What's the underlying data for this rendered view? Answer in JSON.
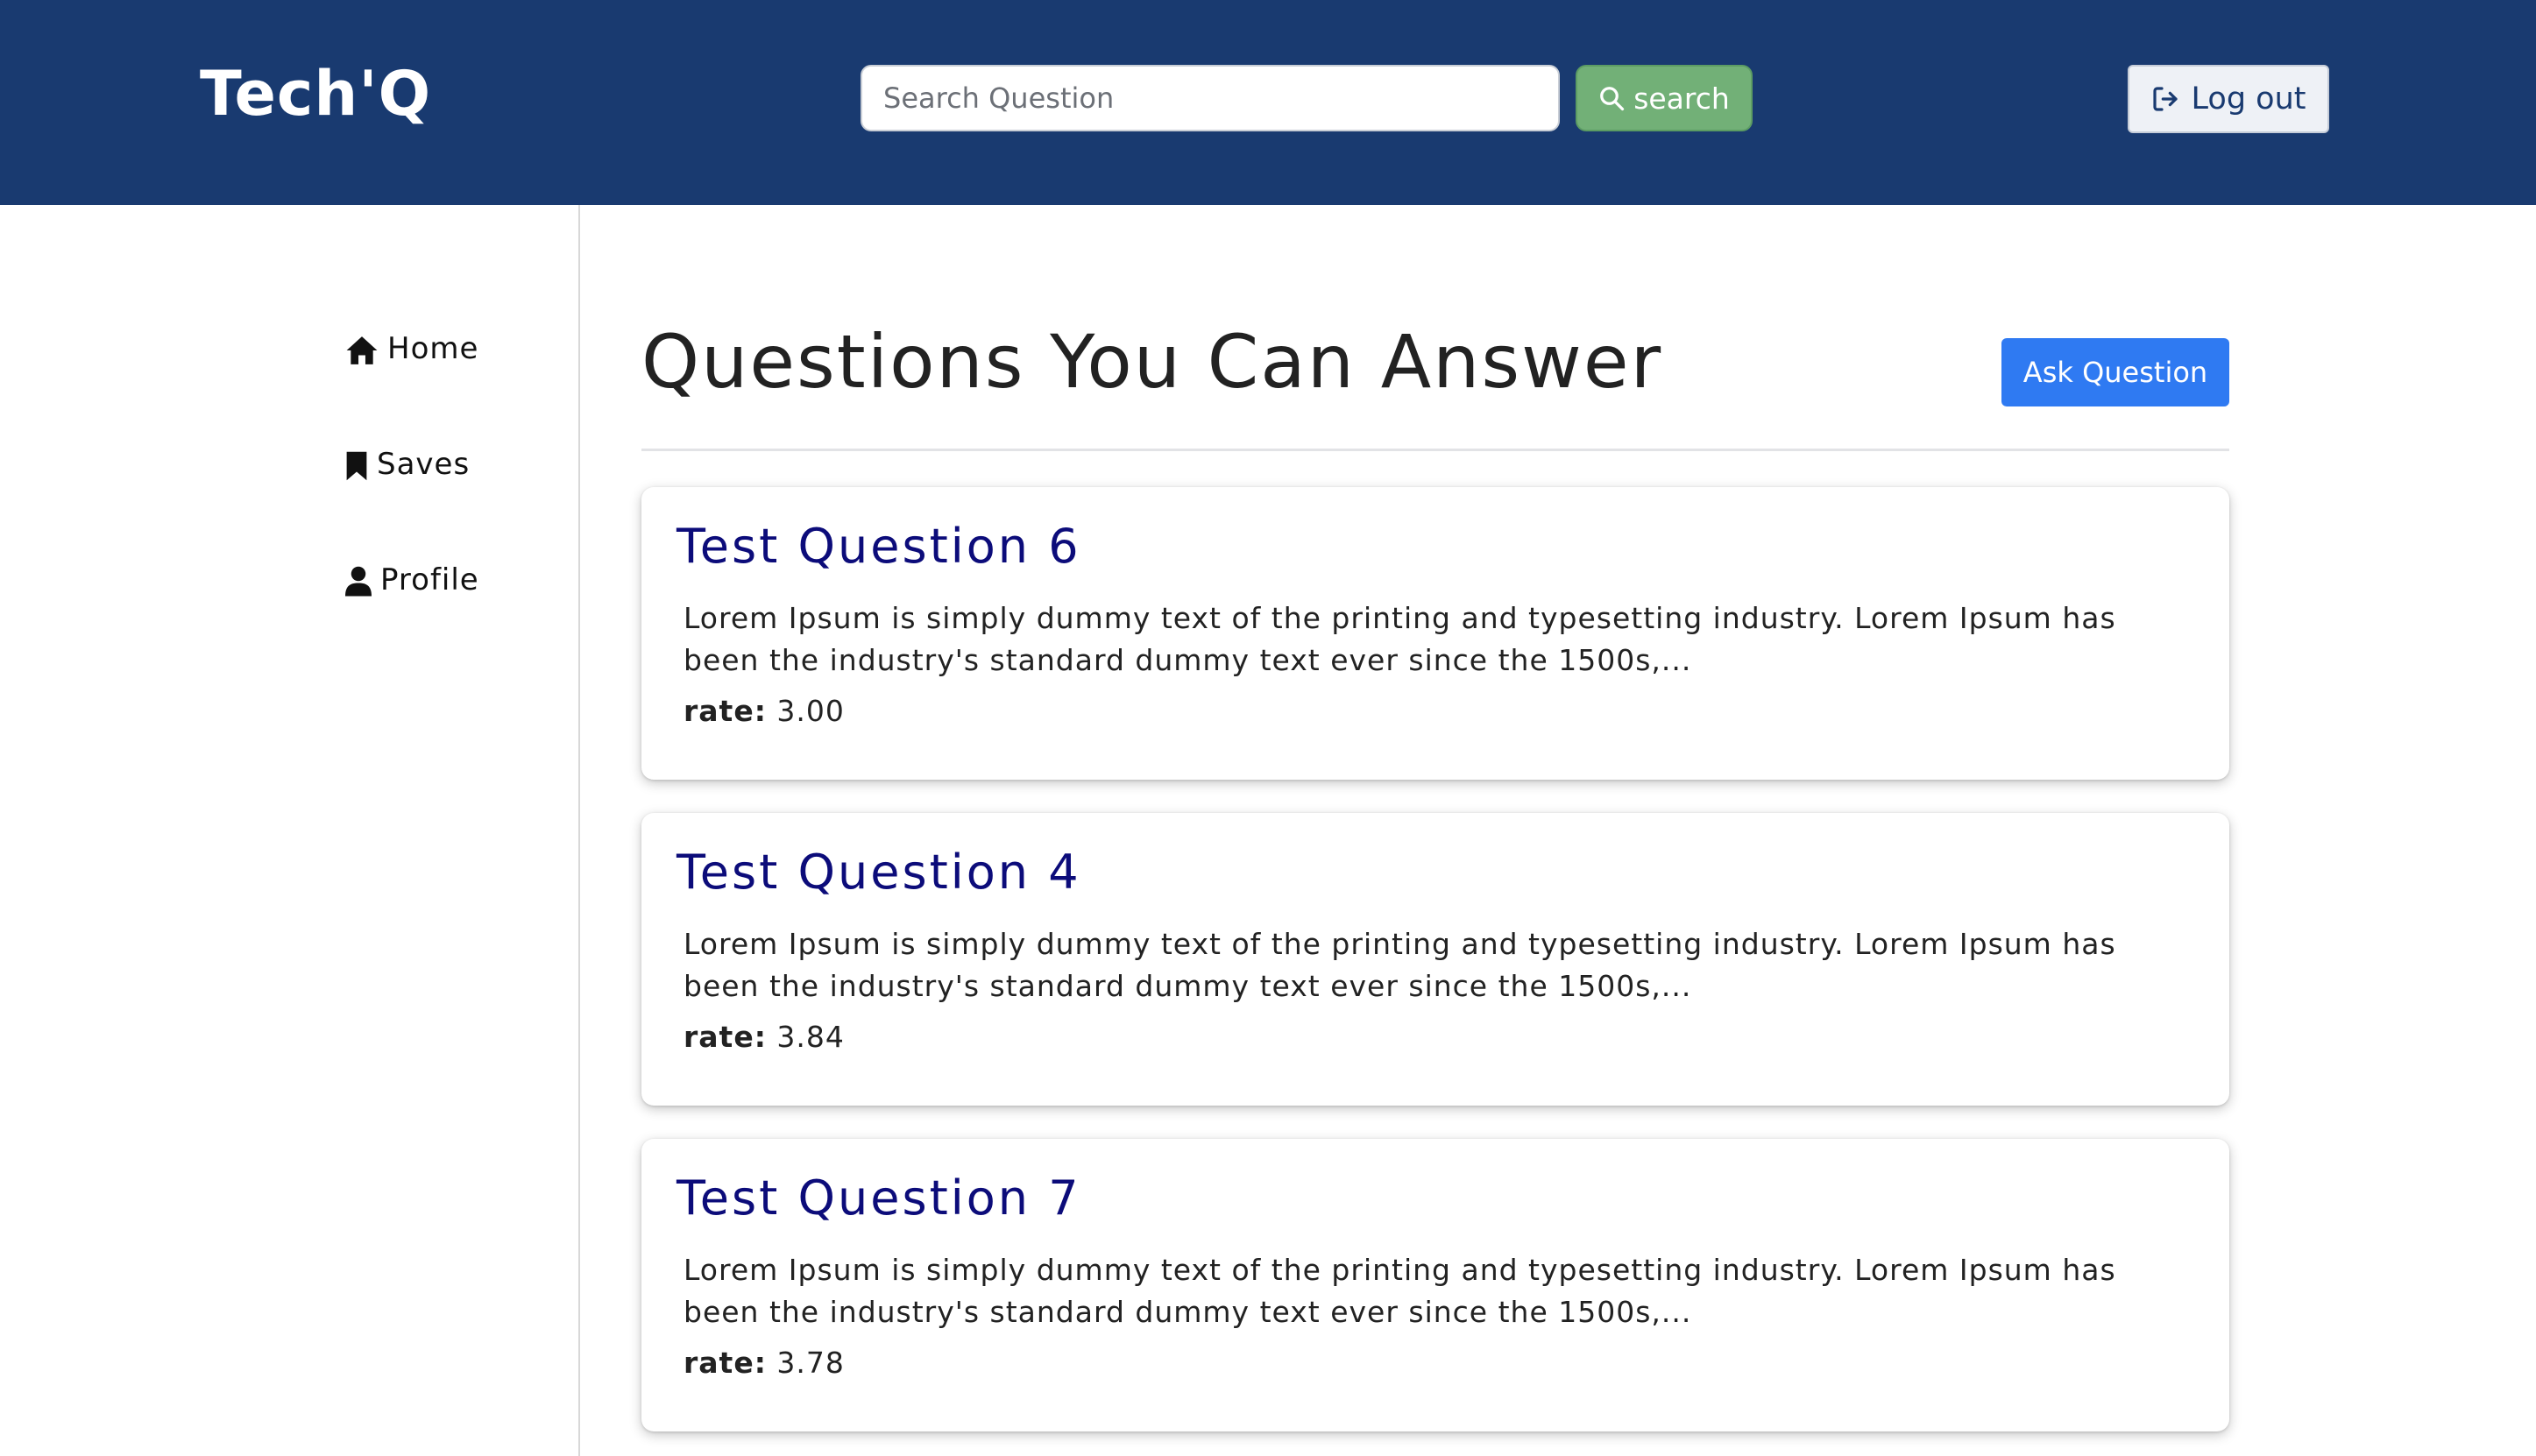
{
  "header": {
    "brand": "Tech'Q",
    "search_placeholder": "Search Question",
    "search_button": "search",
    "logout_button": "Log out"
  },
  "sidebar": {
    "items": [
      {
        "label": "Home",
        "icon": "home-icon"
      },
      {
        "label": "Saves",
        "icon": "bookmark-icon"
      },
      {
        "label": "Profile",
        "icon": "user-icon"
      }
    ]
  },
  "main": {
    "title": "Questions You Can Answer",
    "ask_button": "Ask Question",
    "rate_label": "rate:",
    "questions": [
      {
        "title": "Test Question 6",
        "body": "Lorem Ipsum is simply dummy text of the printing and typesetting industry. Lorem Ipsum has been the industry's standard dummy text ever since the 1500s,...",
        "rate": "3.00"
      },
      {
        "title": "Test Question 4",
        "body": "Lorem Ipsum is simply dummy text of the printing and typesetting industry. Lorem Ipsum has been the industry's standard dummy text ever since the 1500s,...",
        "rate": "3.84"
      },
      {
        "title": "Test Question 7",
        "body": "Lorem Ipsum is simply dummy text of the printing and typesetting industry. Lorem Ipsum has been the industry's standard dummy text ever since the 1500s,...",
        "rate": "3.78"
      }
    ]
  },
  "colors": {
    "header_bg": "#193a70",
    "search_button": "#72b077",
    "ask_button": "#2f7af2",
    "question_title": "#0c0c7a"
  }
}
